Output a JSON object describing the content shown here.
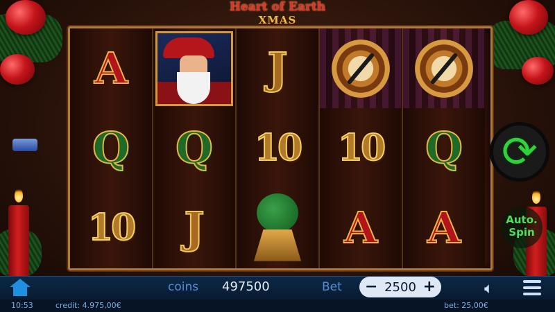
{
  "title": {
    "line1": "Heart of Earth",
    "line2": "XMAS"
  },
  "reels": [
    [
      "A",
      "Q",
      "10"
    ],
    [
      "santa",
      "Q",
      "J"
    ],
    [
      "J",
      "10",
      "tree"
    ],
    [
      "pocket-watch",
      "10",
      "A"
    ],
    [
      "pocket-watch",
      "Q",
      "A"
    ]
  ],
  "controls": {
    "spin_icon": "refresh-icon",
    "auto_spin_label_line1": "Auto.",
    "auto_spin_label_line2": "Spin"
  },
  "bottom_bar": {
    "coins_label": "coins",
    "coins_value": "497500",
    "bet_label": "Bet",
    "bet_value": "2500",
    "minus": "−",
    "plus": "+"
  },
  "status": {
    "time": "10:53",
    "credit": "credit: 4.975,00€",
    "bet": "bet: 25,00€"
  },
  "colors": {
    "spin": "#2ed23a",
    "bar": "#0c2846",
    "accent": "#4f8fd8"
  }
}
